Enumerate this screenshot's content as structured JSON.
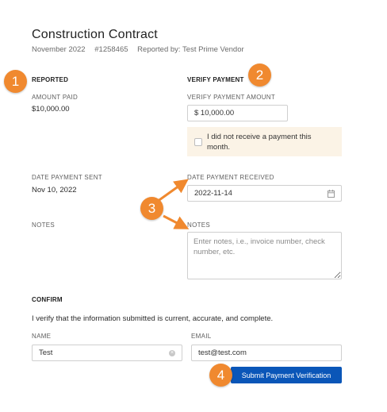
{
  "header": {
    "title": "Construction Contract",
    "period": "November 2022",
    "contract_number": "#1258465",
    "reported_by": "Reported by: Test Prime Vendor"
  },
  "reported": {
    "section_title": "REPORTED",
    "amount_label": "AMOUNT PAID",
    "amount_value": "$10,000.00",
    "date_label": "DATE PAYMENT SENT",
    "date_value": "Nov 10, 2022",
    "notes_label": "NOTES"
  },
  "verify": {
    "section_title": "VERIFY PAYMENT",
    "amount_label": "VERIFY PAYMENT AMOUNT",
    "amount_value": "$ 10,000.00",
    "no_payment_text": "I did not receive a payment this month.",
    "date_label": "DATE PAYMENT RECEIVED",
    "date_value": "2022-11-14",
    "notes_label": "NOTES",
    "notes_placeholder": "Enter notes, i.e., invoice number, check number, etc."
  },
  "confirm": {
    "section_title": "CONFIRM",
    "statement": "I verify that the information submitted is current, accurate, and complete.",
    "name_label": "NAME",
    "name_value": "Test",
    "email_label": "EMAIL",
    "email_value": "test@test.com",
    "submit_label": "Submit Payment Verification"
  },
  "annotations": {
    "badge_1": "1",
    "badge_2": "2",
    "badge_3": "3",
    "badge_4": "4",
    "color": "#f0892f"
  },
  "colors": {
    "primary_button": "#0a56b8",
    "notice_background": "#fbf3e6"
  },
  "icons": {
    "date_picker": "calendar-icon",
    "clear_name": "clear-icon"
  }
}
